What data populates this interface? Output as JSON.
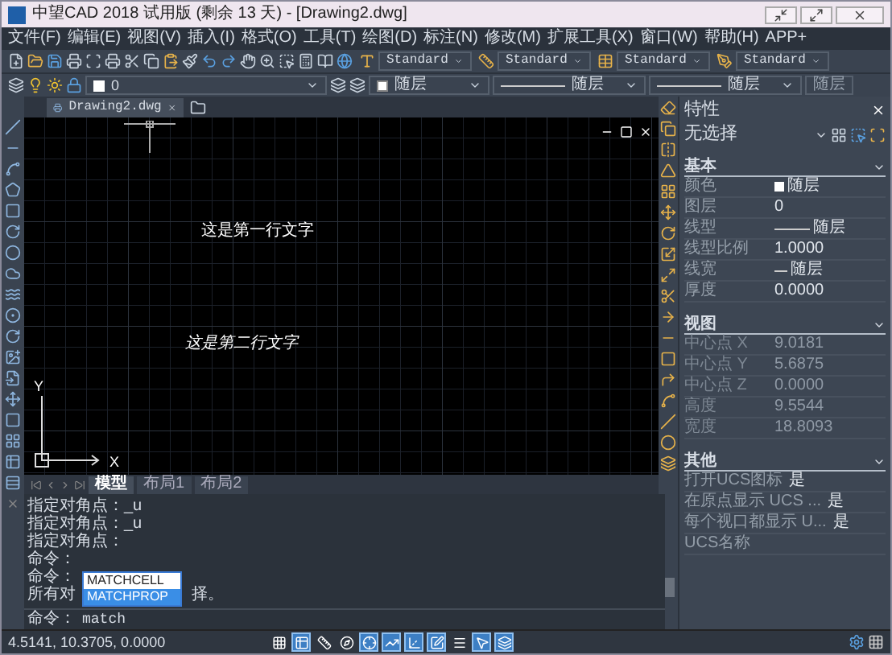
{
  "window": {
    "title": "中望CAD 2018 试用版 (剩余 13 天) - [Drawing2.dwg]"
  },
  "menu": [
    "文件(F)",
    "编辑(E)",
    "视图(V)",
    "插入(I)",
    "格式(O)",
    "工具(T)",
    "绘图(D)",
    "标注(N)",
    "修改(M)",
    "扩展工具(X)",
    "窗口(W)",
    "帮助(H)",
    "APP+"
  ],
  "style_dropdowns": [
    {
      "kind": "text",
      "value": "Standard"
    },
    {
      "kind": "dimension",
      "value": "Standard"
    },
    {
      "kind": "table",
      "value": "Standard"
    },
    {
      "kind": "multileader",
      "value": "Standard"
    }
  ],
  "layer_bar": {
    "layer": "0",
    "color_setting": "随层",
    "linetype": "随层",
    "lineweight": "随层",
    "plot_style": "随层"
  },
  "document_tabs": [
    {
      "label": "Drawing2.dwg",
      "selected": true
    }
  ],
  "canvas": {
    "texts": [
      {
        "text": "这是第一行文字",
        "italic": false
      },
      {
        "text": "这是第二行文字",
        "italic": true
      }
    ],
    "ucs": {
      "y_label": "Y",
      "x_label": "X"
    }
  },
  "layout_tabs": [
    {
      "label": "模型",
      "selected": true
    },
    {
      "label": "布局1",
      "selected": false
    },
    {
      "label": "布局2",
      "selected": false
    }
  ],
  "command": {
    "history": [
      {
        "text": "指定对角点：_u"
      },
      {
        "text": "指定对角点：_u"
      },
      {
        "text": "指定对角点："
      },
      {
        "text": "命令："
      },
      {
        "text": "命令："
      },
      {
        "text": "所有对",
        "after_popup": "择。"
      }
    ],
    "autocomplete": [
      {
        "label": "MATCHCELL",
        "selected": false
      },
      {
        "label": "MATCHPROP",
        "selected": true
      }
    ],
    "prompt": "命令：",
    "input": "match"
  },
  "properties": {
    "title": "特性",
    "selection": "无选择",
    "sections": [
      {
        "title": "基本",
        "rows": [
          {
            "label": "颜色",
            "value": "随层",
            "kind": "color",
            "disabled": false
          },
          {
            "label": "图层",
            "value": "0",
            "kind": "text",
            "disabled": false
          },
          {
            "label": "线型",
            "value": "随层",
            "kind": "linetype",
            "disabled": false
          },
          {
            "label": "线型比例",
            "value": "1.0000",
            "kind": "text",
            "disabled": false
          },
          {
            "label": "线宽",
            "value": "随层",
            "kind": "lineweight",
            "disabled": false
          },
          {
            "label": "厚度",
            "value": "0.0000",
            "kind": "text",
            "disabled": false
          }
        ]
      },
      {
        "title": "视图",
        "rows": [
          {
            "label": "中心点 X",
            "value": "9.0181",
            "kind": "text",
            "disabled": true
          },
          {
            "label": "中心点 Y",
            "value": "5.6875",
            "kind": "text",
            "disabled": true
          },
          {
            "label": "中心点 Z",
            "value": "0.0000",
            "kind": "text",
            "disabled": true
          },
          {
            "label": "高度",
            "value": "9.5544",
            "kind": "text",
            "disabled": true
          },
          {
            "label": "宽度",
            "value": "18.8093",
            "kind": "text",
            "disabled": true
          }
        ]
      },
      {
        "title": "其他",
        "rows": [
          {
            "label": "打开UCS图标",
            "value": "是",
            "kind": "text",
            "disabled": false
          },
          {
            "label": "在原点显示 UCS ...",
            "value": "是",
            "kind": "text",
            "disabled": false
          },
          {
            "label": "每个视口都显示 U...",
            "value": "是",
            "kind": "text",
            "disabled": false
          },
          {
            "label": "UCS名称",
            "kind": "text",
            "disabled": false
          }
        ]
      }
    ]
  },
  "status_bar": {
    "coordinates": "4.5141, 10.3705, 0.0000",
    "toggles": [
      {
        "kind": "grid",
        "on": false
      },
      {
        "kind": "snap",
        "on": true
      },
      {
        "kind": "ortho",
        "on": false
      },
      {
        "kind": "polar",
        "on": false
      },
      {
        "kind": "osnap",
        "on": true
      },
      {
        "kind": "otrack",
        "on": true
      },
      {
        "kind": "ducs",
        "on": true
      },
      {
        "kind": "dyn",
        "on": true
      },
      {
        "kind": "lwt",
        "on": false
      },
      {
        "kind": "tp",
        "on": true
      },
      {
        "kind": "qp",
        "on": true
      }
    ]
  }
}
